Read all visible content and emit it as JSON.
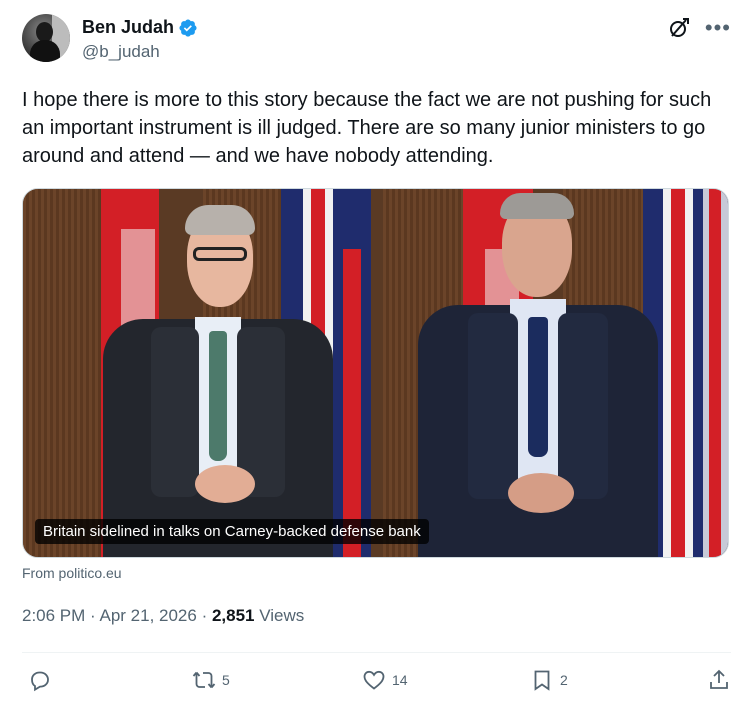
{
  "author": {
    "display_name": "Ben Judah",
    "handle": "@b_judah",
    "verified_icon": "verified-badge-icon",
    "avatar_icon": "avatar-photo"
  },
  "tweet": {
    "text": "I hope there is more to this story because the fact we are not pushing for such an important instrument is ill judged. There are so many junior ministers to go around and attend — and we have nobody attending."
  },
  "card": {
    "caption": "Britain sidelined in talks on Carney-backed defense bank",
    "source": "From politico.eu"
  },
  "meta": {
    "time": "2:06 PM",
    "sep1": " · ",
    "date": "Apr 21, 2026",
    "sep2": " · ",
    "views_count": "2,851",
    "views_label": " Views"
  },
  "actions": {
    "reply_count": "",
    "repost_count": "5",
    "like_count": "14",
    "bookmark_count": "2"
  },
  "colors": {
    "accent": "#1d9bf0",
    "text_primary": "#0f1419",
    "text_secondary": "#536471"
  }
}
